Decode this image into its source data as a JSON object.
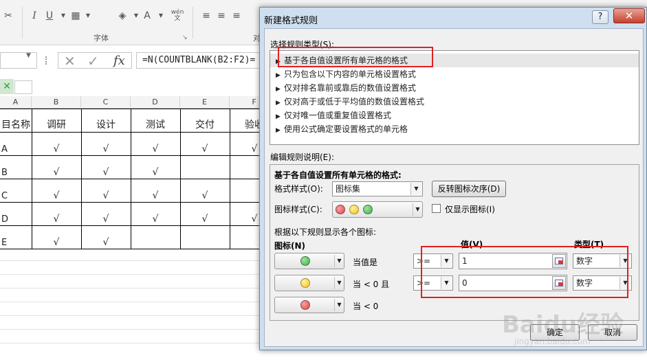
{
  "ribbon": {
    "group_font_label": "字体",
    "group_align_fragment": "对",
    "buttons": [
      "I",
      "U",
      "A",
      "wén 文"
    ]
  },
  "formula_bar": {
    "name_box_value": "",
    "cancel_glyph": "✕",
    "enter_glyph": "✓",
    "fx_label": "fx",
    "formula": "=N(COUNTBLANK(B2:F2)="
  },
  "sheet": {
    "column_headers": [
      "A",
      "B",
      "C",
      "D",
      "E",
      "F"
    ],
    "header_row": [
      "目名称",
      "调研",
      "设计",
      "测试",
      "交付",
      "验收"
    ],
    "rows": [
      {
        "name": "A",
        "cells": [
          "√",
          "√",
          "√",
          "√",
          "√"
        ]
      },
      {
        "name": "B",
        "cells": [
          "√",
          "√",
          "√",
          "",
          ""
        ]
      },
      {
        "name": "C",
        "cells": [
          "√",
          "√",
          "√",
          "√",
          ""
        ]
      },
      {
        "name": "D",
        "cells": [
          "√",
          "√",
          "√",
          "√",
          "√"
        ]
      },
      {
        "name": "E",
        "cells": [
          "√",
          "√",
          "",
          "",
          ""
        ]
      }
    ]
  },
  "dialog": {
    "title": "新建格式规则",
    "help": "?",
    "close": "✕",
    "select_rule_type_label": "选择规则类型(S):",
    "rule_types": [
      "基于各自值设置所有单元格的格式",
      "只为包含以下内容的单元格设置格式",
      "仅对排名靠前或靠后的数值设置格式",
      "仅对高于或低于平均值的数值设置格式",
      "仅对唯一值或重复值设置格式",
      "使用公式确定要设置格式的单元格"
    ],
    "selected_rule_index": 0,
    "edit_rule_label": "编辑规则说明(E):",
    "desc_heading": "基于各自值设置所有单元格的格式:",
    "format_style_label": "格式样式(O):",
    "format_style_value": "图标集",
    "reverse_button": "反转图标次序(D)",
    "icon_style_label": "图标样式(C):",
    "show_icon_only_label": "仅显示图标(I)",
    "show_icon_only_checked": false,
    "rules_intro": "根据以下规则显示各个图标:",
    "col_icon": "图标(N)",
    "col_value": "值(V)",
    "col_type": "类型(T)",
    "icon_colors": {
      "green": "#3cb043",
      "yellow": "#f5c518",
      "red": "#e04545"
    },
    "rows": [
      {
        "icon": "green-circle",
        "condition": "当值是",
        "operator": ">=",
        "value": "1",
        "type": "数字"
      },
      {
        "icon": "yellow-circle",
        "condition": "当 < 0 且",
        "operator": ">=",
        "value": "0",
        "type": "数字"
      },
      {
        "icon": "red-circle",
        "condition": "当 < 0"
      }
    ],
    "ok_button": "确定",
    "cancel_button": "取消"
  },
  "watermark": {
    "brand": "Baidu经验",
    "url": "jingyan.baidu.com"
  }
}
